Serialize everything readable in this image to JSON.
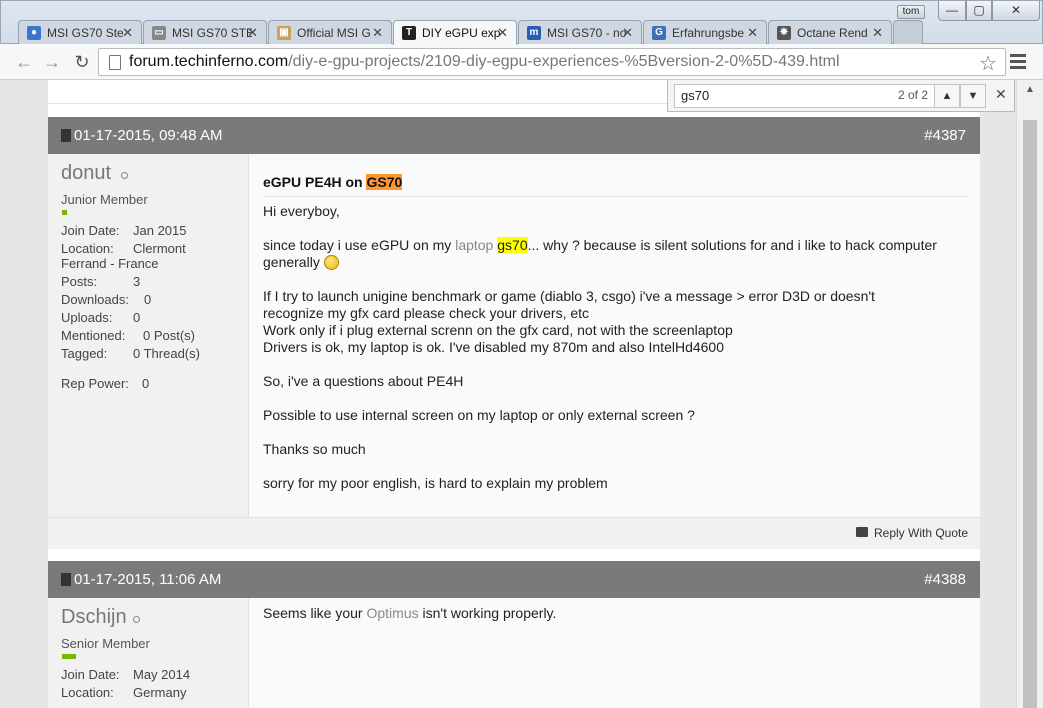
{
  "window": {
    "profile": "tom",
    "min_glyph": "—",
    "max_glyph": "▢",
    "close_glyph": "✕"
  },
  "tabs": [
    {
      "title": "MSI GS70 Ste",
      "icon": "tab-favicon",
      "color": "#3a76c9",
      "glyph": "●"
    },
    {
      "title": "MSI GS70 STE",
      "icon": "tab-favicon",
      "color": "#888888",
      "glyph": "▭"
    },
    {
      "title": "Official MSI G",
      "icon": "tab-favicon",
      "color": "#c9a05c",
      "glyph": "▣"
    },
    {
      "title": "DIY eGPU exp",
      "icon": "tab-favicon",
      "color": "#222222",
      "glyph": "T"
    },
    {
      "title": "MSI GS70 - no",
      "icon": "tab-favicon",
      "color": "#2b5db8",
      "glyph": "m"
    },
    {
      "title": "Erfahrungsbe",
      "icon": "tab-favicon",
      "color": "#3f6fb8",
      "glyph": "G"
    },
    {
      "title": "Octane Rend",
      "icon": "tab-favicon",
      "color": "#555555",
      "glyph": "✵"
    }
  ],
  "tab_close_glyph": "✕",
  "toolbar": {
    "back": "←",
    "forward": "→",
    "reload": "↻",
    "url_host": "forum.techinferno.com",
    "url_path": "/diy-e-gpu-projects/2109-diy-egpu-experiences-%5Bversion-2-0%5D-439.html",
    "star": "☆"
  },
  "find": {
    "query": "gs70",
    "count": "2 of 2",
    "prev": "▲",
    "next": "▼",
    "close": "✕"
  },
  "scroll_up": "▲",
  "posts": [
    {
      "date": "01-17-2015, 09:48 AM",
      "number": "#4387",
      "username": "donut",
      "usertitle": "Junior Member",
      "join_label": "Join Date:",
      "join_value": "Jan 2015",
      "location_label": "Location:",
      "location_value": "Clermont",
      "location_value2": "Ferrand - France",
      "posts_label": "Posts:",
      "posts_value": "3",
      "downloads_label": "Downloads:",
      "downloads_value": "0",
      "uploads_label": "Uploads:",
      "uploads_value": "0",
      "mentioned_label": "Mentioned:",
      "mentioned_value": "0 Post(s)",
      "tagged_label": "Tagged:",
      "tagged_value": "0 Thread(s)",
      "rep_label": "Rep Power:",
      "rep_value": "0",
      "title_prefix": "eGPU PE4H on ",
      "title_match": "GS70",
      "line1": "Hi everyboy,",
      "line2_a": "since today i use eGPU on my ",
      "line2_link": "laptop",
      "line2_match": "gs70",
      "line2_b": "... why ? because is silent solutions for and i like to hack computer",
      "line3": "generally ",
      "line4": "If I try to launch unigine benchmark or game (diablo 3, csgo) i've a message > error D3D or doesn't",
      "line5": "recognize my gfx card please check your drivers, etc",
      "line6": "Work only if i plug external screnn on the gfx card, not with the screenlaptop",
      "line7": "Drivers is ok, my laptop is ok. I've disabled my 870m and also IntelHd4600",
      "line8": "So, i've a questions about PE4H",
      "line9": "Possible to use internal screen on my laptop or only external screen ?",
      "line10": "Thanks so much",
      "line11": "sorry for my poor english, is hard to explain my problem",
      "reply": "Reply With Quote"
    },
    {
      "date": "01-17-2015, 11:06 AM",
      "number": "#4388",
      "username": "Dschijn",
      "usertitle": "Senior Member",
      "join_label": "Join Date:",
      "join_value": "May 2014",
      "location_label": "Location:",
      "location_value": "Germany",
      "msg_a": "Seems like your ",
      "msg_link": "Optimus",
      "msg_b": " isn't working properly."
    }
  ]
}
